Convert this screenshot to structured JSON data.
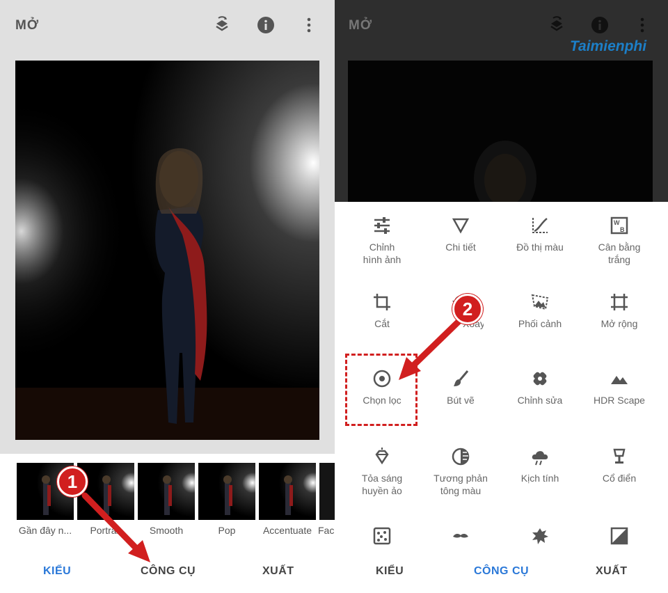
{
  "left": {
    "title": "MỞ",
    "header_icons": [
      "layers-history-icon",
      "info-icon",
      "more-vert-icon"
    ],
    "filters": [
      {
        "label": "Gần đây n..."
      },
      {
        "label": "Portrait"
      },
      {
        "label": "Smooth"
      },
      {
        "label": "Pop"
      },
      {
        "label": "Accentuate"
      },
      {
        "label": "Fac"
      }
    ],
    "tabs": [
      {
        "label": "KIỂU",
        "active": true
      },
      {
        "label": "CÔNG CỤ",
        "active": false
      },
      {
        "label": "XUẤT",
        "active": false
      }
    ],
    "step_badge": "1"
  },
  "right": {
    "title": "MỞ",
    "header_icons": [
      "layers-history-icon",
      "info-icon",
      "more-vert-icon"
    ],
    "watermark": "Taimienphi",
    "tools": [
      {
        "label": "Chỉnh hình ảnh",
        "icon": "tune-sliders-icon"
      },
      {
        "label": "Chi tiết",
        "icon": "triangle-details-icon"
      },
      {
        "label": "Đồ thị màu",
        "icon": "curves-icon"
      },
      {
        "label": "Cân bằng trắng",
        "icon": "white-balance-icon"
      },
      {
        "label": "Cắt",
        "icon": "crop-icon"
      },
      {
        "label": "Xoay",
        "icon": "rotate-icon"
      },
      {
        "label": "Phối cảnh",
        "icon": "perspective-icon"
      },
      {
        "label": "Mở rộng",
        "icon": "expand-icon"
      },
      {
        "label": "Chọn lọc",
        "icon": "selective-target-icon"
      },
      {
        "label": "Bút vẽ",
        "icon": "brush-icon"
      },
      {
        "label": "Chỉnh sửa",
        "icon": "healing-bandage-icon"
      },
      {
        "label": "HDR Scape",
        "icon": "mountains-icon"
      },
      {
        "label": "Tỏa sáng huyền ảo",
        "icon": "glamour-glow-icon"
      },
      {
        "label": "Tương phản tông màu",
        "icon": "tonal-contrast-icon"
      },
      {
        "label": "Kịch tính",
        "icon": "drama-cloud-icon"
      },
      {
        "label": "Cổ điển",
        "icon": "vintage-lamp-icon"
      },
      {
        "label": "",
        "icon": "grainy-film-icon"
      },
      {
        "label": "",
        "icon": "mustache-icon"
      },
      {
        "label": "",
        "icon": "grunge-icon"
      },
      {
        "label": "",
        "icon": "black-white-icon"
      }
    ],
    "tabs": [
      {
        "label": "KIỂU",
        "active": false
      },
      {
        "label": "CÔNG CỤ",
        "active": true
      },
      {
        "label": "XUẤT",
        "active": false
      }
    ],
    "step_badge": "2"
  },
  "colors": {
    "accent": "#2f80ed",
    "annotation": "#d11f1f",
    "active_tab": "#2a78d8"
  }
}
